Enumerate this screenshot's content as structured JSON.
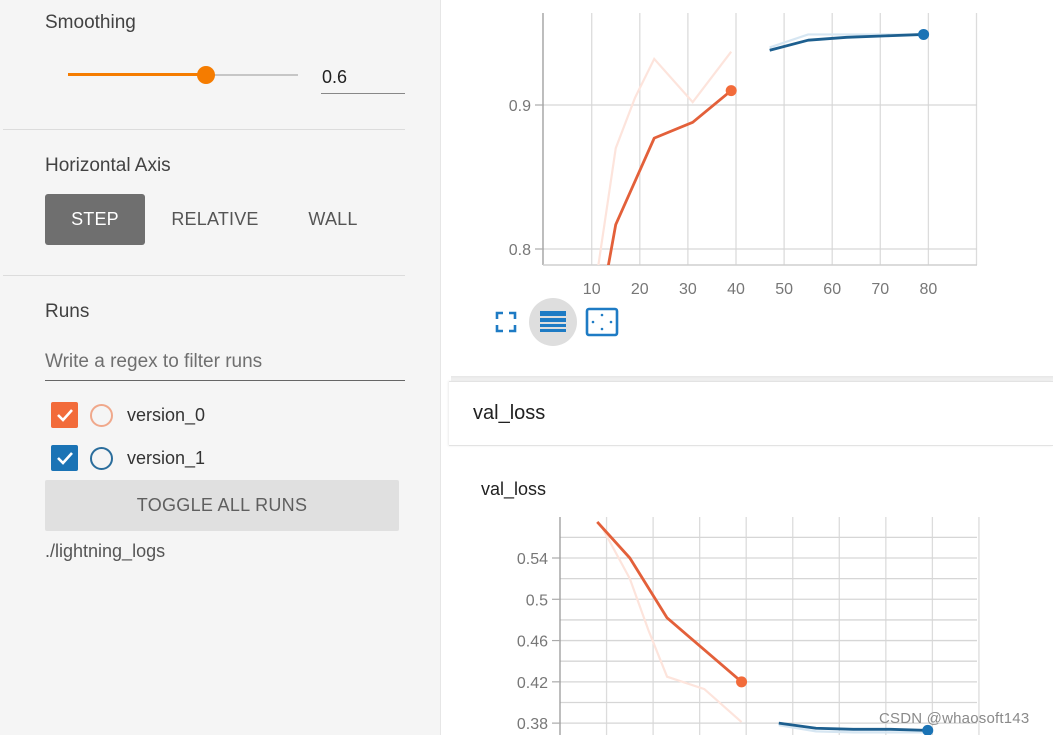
{
  "sidebar": {
    "smoothing": {
      "label": "Smoothing",
      "value": "0.6",
      "slider_fraction": 0.6
    },
    "horizontal_axis": {
      "label": "Horizontal Axis",
      "options": [
        "STEP",
        "RELATIVE",
        "WALL"
      ],
      "selected": "STEP"
    },
    "runs": {
      "label": "Runs",
      "filter_placeholder": "Write a regex to filter runs",
      "filter_value": "",
      "items": [
        {
          "name": "version_0",
          "checked": true,
          "color": "#f26b3a"
        },
        {
          "name": "version_1",
          "checked": true,
          "color": "#1a73b5"
        }
      ],
      "toggle_all_label": "TOGGLE ALL RUNS",
      "log_dir": "./lightning_logs"
    }
  },
  "main": {
    "chart_toolbar": [
      {
        "icon": "fullscreen-icon",
        "active": false
      },
      {
        "icon": "toggle-log-scale-icon",
        "active": true
      },
      {
        "icon": "fit-domain-icon",
        "active": false
      }
    ],
    "group_title": "val_loss",
    "chart_title": "val_loss"
  },
  "watermark": "CSDN @whaosoft143",
  "chart_data": [
    {
      "type": "line",
      "title": "",
      "xlabel": "",
      "ylabel": "",
      "x_ticks": [
        10,
        20,
        30,
        40,
        50,
        60,
        70,
        80
      ],
      "y_ticks": [
        "0.8",
        "0.9"
      ],
      "y_tick_values": [
        0.8,
        0.9
      ],
      "xlim": [
        0,
        90
      ],
      "ylim_visible": [
        0.789,
        0.963
      ],
      "grid": true,
      "smoothing": 0.6,
      "series": [
        {
          "name": "version_0",
          "color": "#f26b3a",
          "smoothed": [
            [
              13,
              0.78
            ],
            [
              15,
              0.817
            ],
            [
              23,
              0.877
            ],
            [
              31,
              0.888
            ],
            [
              39,
              0.91
            ]
          ],
          "raw": [
            [
              11,
              0.78
            ],
            [
              15,
              0.87
            ],
            [
              19,
              0.905
            ],
            [
              23,
              0.932
            ],
            [
              31,
              0.902
            ],
            [
              39,
              0.937
            ]
          ]
        },
        {
          "name": "version_1",
          "color": "#1a73b5",
          "smoothed": [
            [
              47,
              0.938
            ],
            [
              55,
              0.945
            ],
            [
              63,
              0.947
            ],
            [
              71,
              0.948
            ],
            [
              79,
              0.949
            ]
          ],
          "raw": [
            [
              47,
              0.94
            ],
            [
              55,
              0.949
            ],
            [
              63,
              0.949
            ],
            [
              71,
              0.949
            ],
            [
              79,
              0.949
            ]
          ]
        }
      ]
    },
    {
      "type": "line",
      "title": "val_loss",
      "xlabel": "",
      "ylabel": "",
      "y_ticks": [
        "0.54",
        "0.5",
        "0.46",
        "0.42",
        "0.38"
      ],
      "y_tick_values": [
        0.54,
        0.5,
        0.46,
        0.42,
        0.38
      ],
      "ylim_visible": [
        0.37,
        0.575
      ],
      "xlim": [
        0,
        90
      ],
      "grid": true,
      "smoothing": 0.6,
      "series": [
        {
          "name": "version_0",
          "color": "#f26b3a",
          "smoothed": [
            [
              8,
              0.575
            ],
            [
              15,
              0.54
            ],
            [
              23,
              0.482
            ],
            [
              31,
              0.451
            ],
            [
              39,
              0.42
            ]
          ],
          "raw": [
            [
              9,
              0.57
            ],
            [
              15,
              0.52
            ],
            [
              19,
              0.47
            ],
            [
              23,
              0.425
            ],
            [
              31,
              0.413
            ],
            [
              39,
              0.381
            ]
          ]
        },
        {
          "name": "version_1",
          "color": "#1a73b5",
          "smoothed": [
            [
              47,
              0.38
            ],
            [
              55,
              0.375
            ],
            [
              63,
              0.374
            ],
            [
              71,
              0.374
            ],
            [
              79,
              0.373
            ]
          ],
          "raw": [
            [
              47,
              0.378
            ],
            [
              55,
              0.372
            ],
            [
              63,
              0.371
            ],
            [
              71,
              0.371
            ],
            [
              79,
              0.371
            ]
          ]
        }
      ]
    }
  ]
}
